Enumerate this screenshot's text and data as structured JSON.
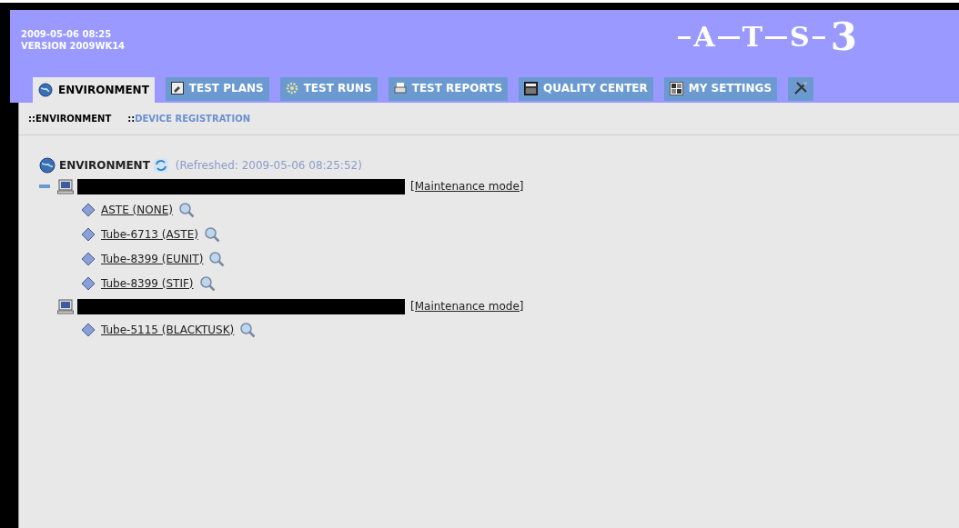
{
  "header": {
    "datetime": "2009-05-06 08:25",
    "version": "VERSION 2009WK14",
    "logo_letters": [
      "A",
      "T",
      "S",
      "3"
    ]
  },
  "tabs": [
    {
      "label": "ENVIRONMENT",
      "kind": "globe",
      "selected": true
    },
    {
      "label": "TEST PLANS",
      "kind": "plan",
      "selected": false
    },
    {
      "label": "TEST RUNS",
      "kind": "gear",
      "selected": false
    },
    {
      "label": "TEST REPORTS",
      "kind": "printer",
      "selected": false
    },
    {
      "label": "QUALITY CENTER",
      "kind": "clapper",
      "selected": false
    },
    {
      "label": "MY SETTINGS",
      "kind": "grid",
      "selected": false
    },
    {
      "kind": "tools",
      "selected": false
    }
  ],
  "subnav": [
    {
      "prefix": "::",
      "label": "ENVIRONMENT",
      "selected": true
    },
    {
      "prefix": "::",
      "label": "DEVICE REGISTRATION",
      "selected": false
    }
  ],
  "tree": {
    "title": "ENVIRONMENT",
    "refreshed": "(Refreshed: 2009-05-06 08:25:52)",
    "devices": [
      {
        "collapse_button": true,
        "redacted": true,
        "mode_link": "[Maintenance mode]",
        "children": [
          {
            "label": "ASTE (NONE)"
          },
          {
            "label": "Tube-6713 (ASTE)"
          },
          {
            "label": "Tube-8399 (EUNIT)"
          },
          {
            "label": "Tube-8399 (STIF)"
          }
        ]
      },
      {
        "collapse_button": false,
        "redacted": true,
        "mode_link": "[Maintenance mode]",
        "children": [
          {
            "label": "Tube-5115 (BLACKTUSK)"
          }
        ]
      }
    ]
  }
}
